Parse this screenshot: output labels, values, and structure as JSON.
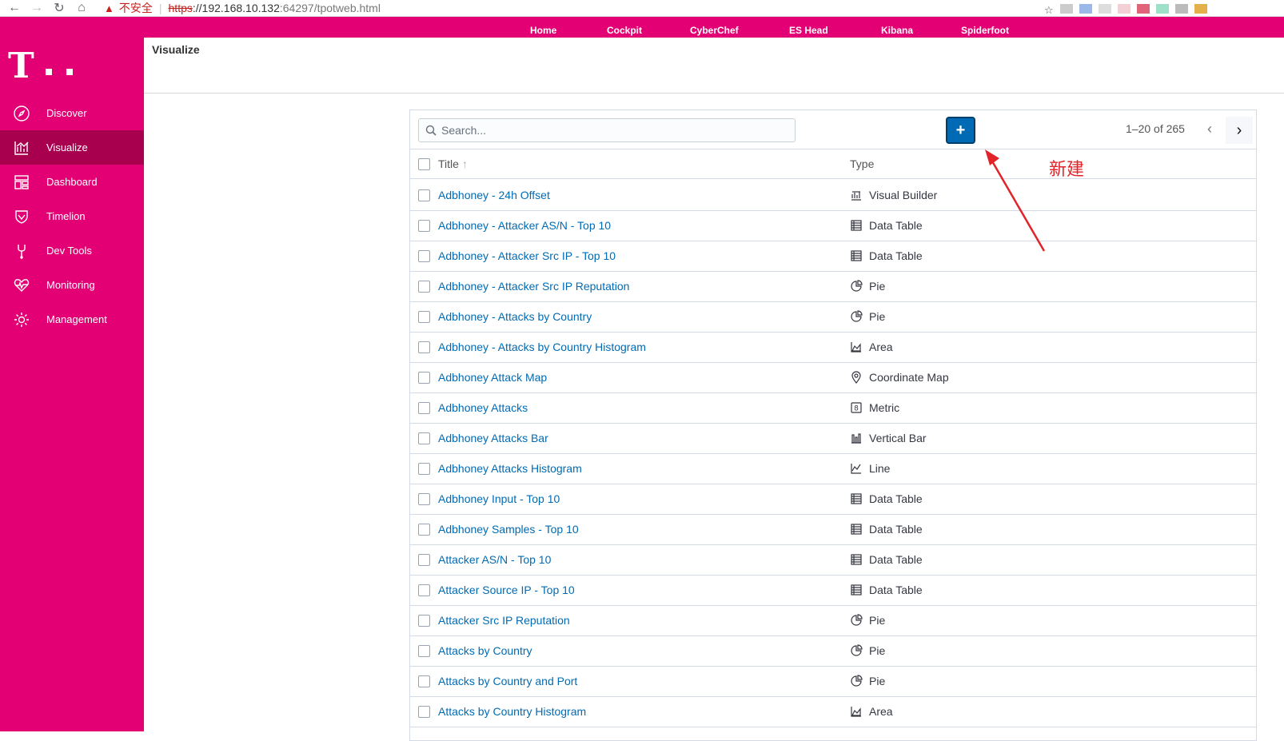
{
  "browser": {
    "insecure_label": "不安全",
    "url_scheme": "https",
    "url_host": "://192.168.10.132",
    "url_rest": ":64297/tpotweb.html"
  },
  "topnav": [
    "Home",
    "Cockpit",
    "CyberChef",
    "ES Head",
    "Kibana",
    "Spiderfoot"
  ],
  "sidebar": {
    "items": [
      {
        "label": "Discover",
        "icon": "compass-icon"
      },
      {
        "label": "Visualize",
        "icon": "chart-icon"
      },
      {
        "label": "Dashboard",
        "icon": "dashboard-icon"
      },
      {
        "label": "Timelion",
        "icon": "shield-icon"
      },
      {
        "label": "Dev Tools",
        "icon": "wrench-icon"
      },
      {
        "label": "Monitoring",
        "icon": "heartbeat-icon"
      },
      {
        "label": "Management",
        "icon": "gear-icon"
      }
    ],
    "active": "Visualize"
  },
  "page": {
    "title": "Visualize"
  },
  "toolbar": {
    "search_placeholder": "Search...",
    "add_label": "+",
    "pager": "1–20 of 265"
  },
  "table": {
    "col_title": "Title",
    "col_type": "Type",
    "rows": [
      {
        "title": "Adbhoney - 24h Offset",
        "type": "Visual Builder",
        "icon": "builder-icon"
      },
      {
        "title": "Adbhoney - Attacker AS/N - Top 10",
        "type": "Data Table",
        "icon": "table-icon"
      },
      {
        "title": "Adbhoney - Attacker Src IP - Top 10",
        "type": "Data Table",
        "icon": "table-icon"
      },
      {
        "title": "Adbhoney - Attacker Src IP Reputation",
        "type": "Pie",
        "icon": "pie-icon"
      },
      {
        "title": "Adbhoney - Attacks by Country",
        "type": "Pie",
        "icon": "pie-icon"
      },
      {
        "title": "Adbhoney - Attacks by Country Histogram",
        "type": "Area",
        "icon": "area-icon"
      },
      {
        "title": "Adbhoney Attack Map",
        "type": "Coordinate Map",
        "icon": "map-pin-icon"
      },
      {
        "title": "Adbhoney Attacks",
        "type": "Metric",
        "icon": "metric-icon"
      },
      {
        "title": "Adbhoney Attacks Bar",
        "type": "Vertical Bar",
        "icon": "bar-icon"
      },
      {
        "title": "Adbhoney Attacks Histogram",
        "type": "Line",
        "icon": "line-icon"
      },
      {
        "title": "Adbhoney Input - Top 10",
        "type": "Data Table",
        "icon": "table-icon"
      },
      {
        "title": "Adbhoney Samples - Top 10",
        "type": "Data Table",
        "icon": "table-icon"
      },
      {
        "title": "Attacker AS/N - Top 10",
        "type": "Data Table",
        "icon": "table-icon"
      },
      {
        "title": "Attacker Source IP - Top 10",
        "type": "Data Table",
        "icon": "table-icon"
      },
      {
        "title": "Attacker Src IP Reputation",
        "type": "Pie",
        "icon": "pie-icon"
      },
      {
        "title": "Attacks by Country",
        "type": "Pie",
        "icon": "pie-icon"
      },
      {
        "title": "Attacks by Country and Port",
        "type": "Pie",
        "icon": "pie-icon"
      },
      {
        "title": "Attacks by Country Histogram",
        "type": "Area",
        "icon": "area-icon"
      }
    ]
  },
  "annotation": {
    "label": "新建"
  }
}
